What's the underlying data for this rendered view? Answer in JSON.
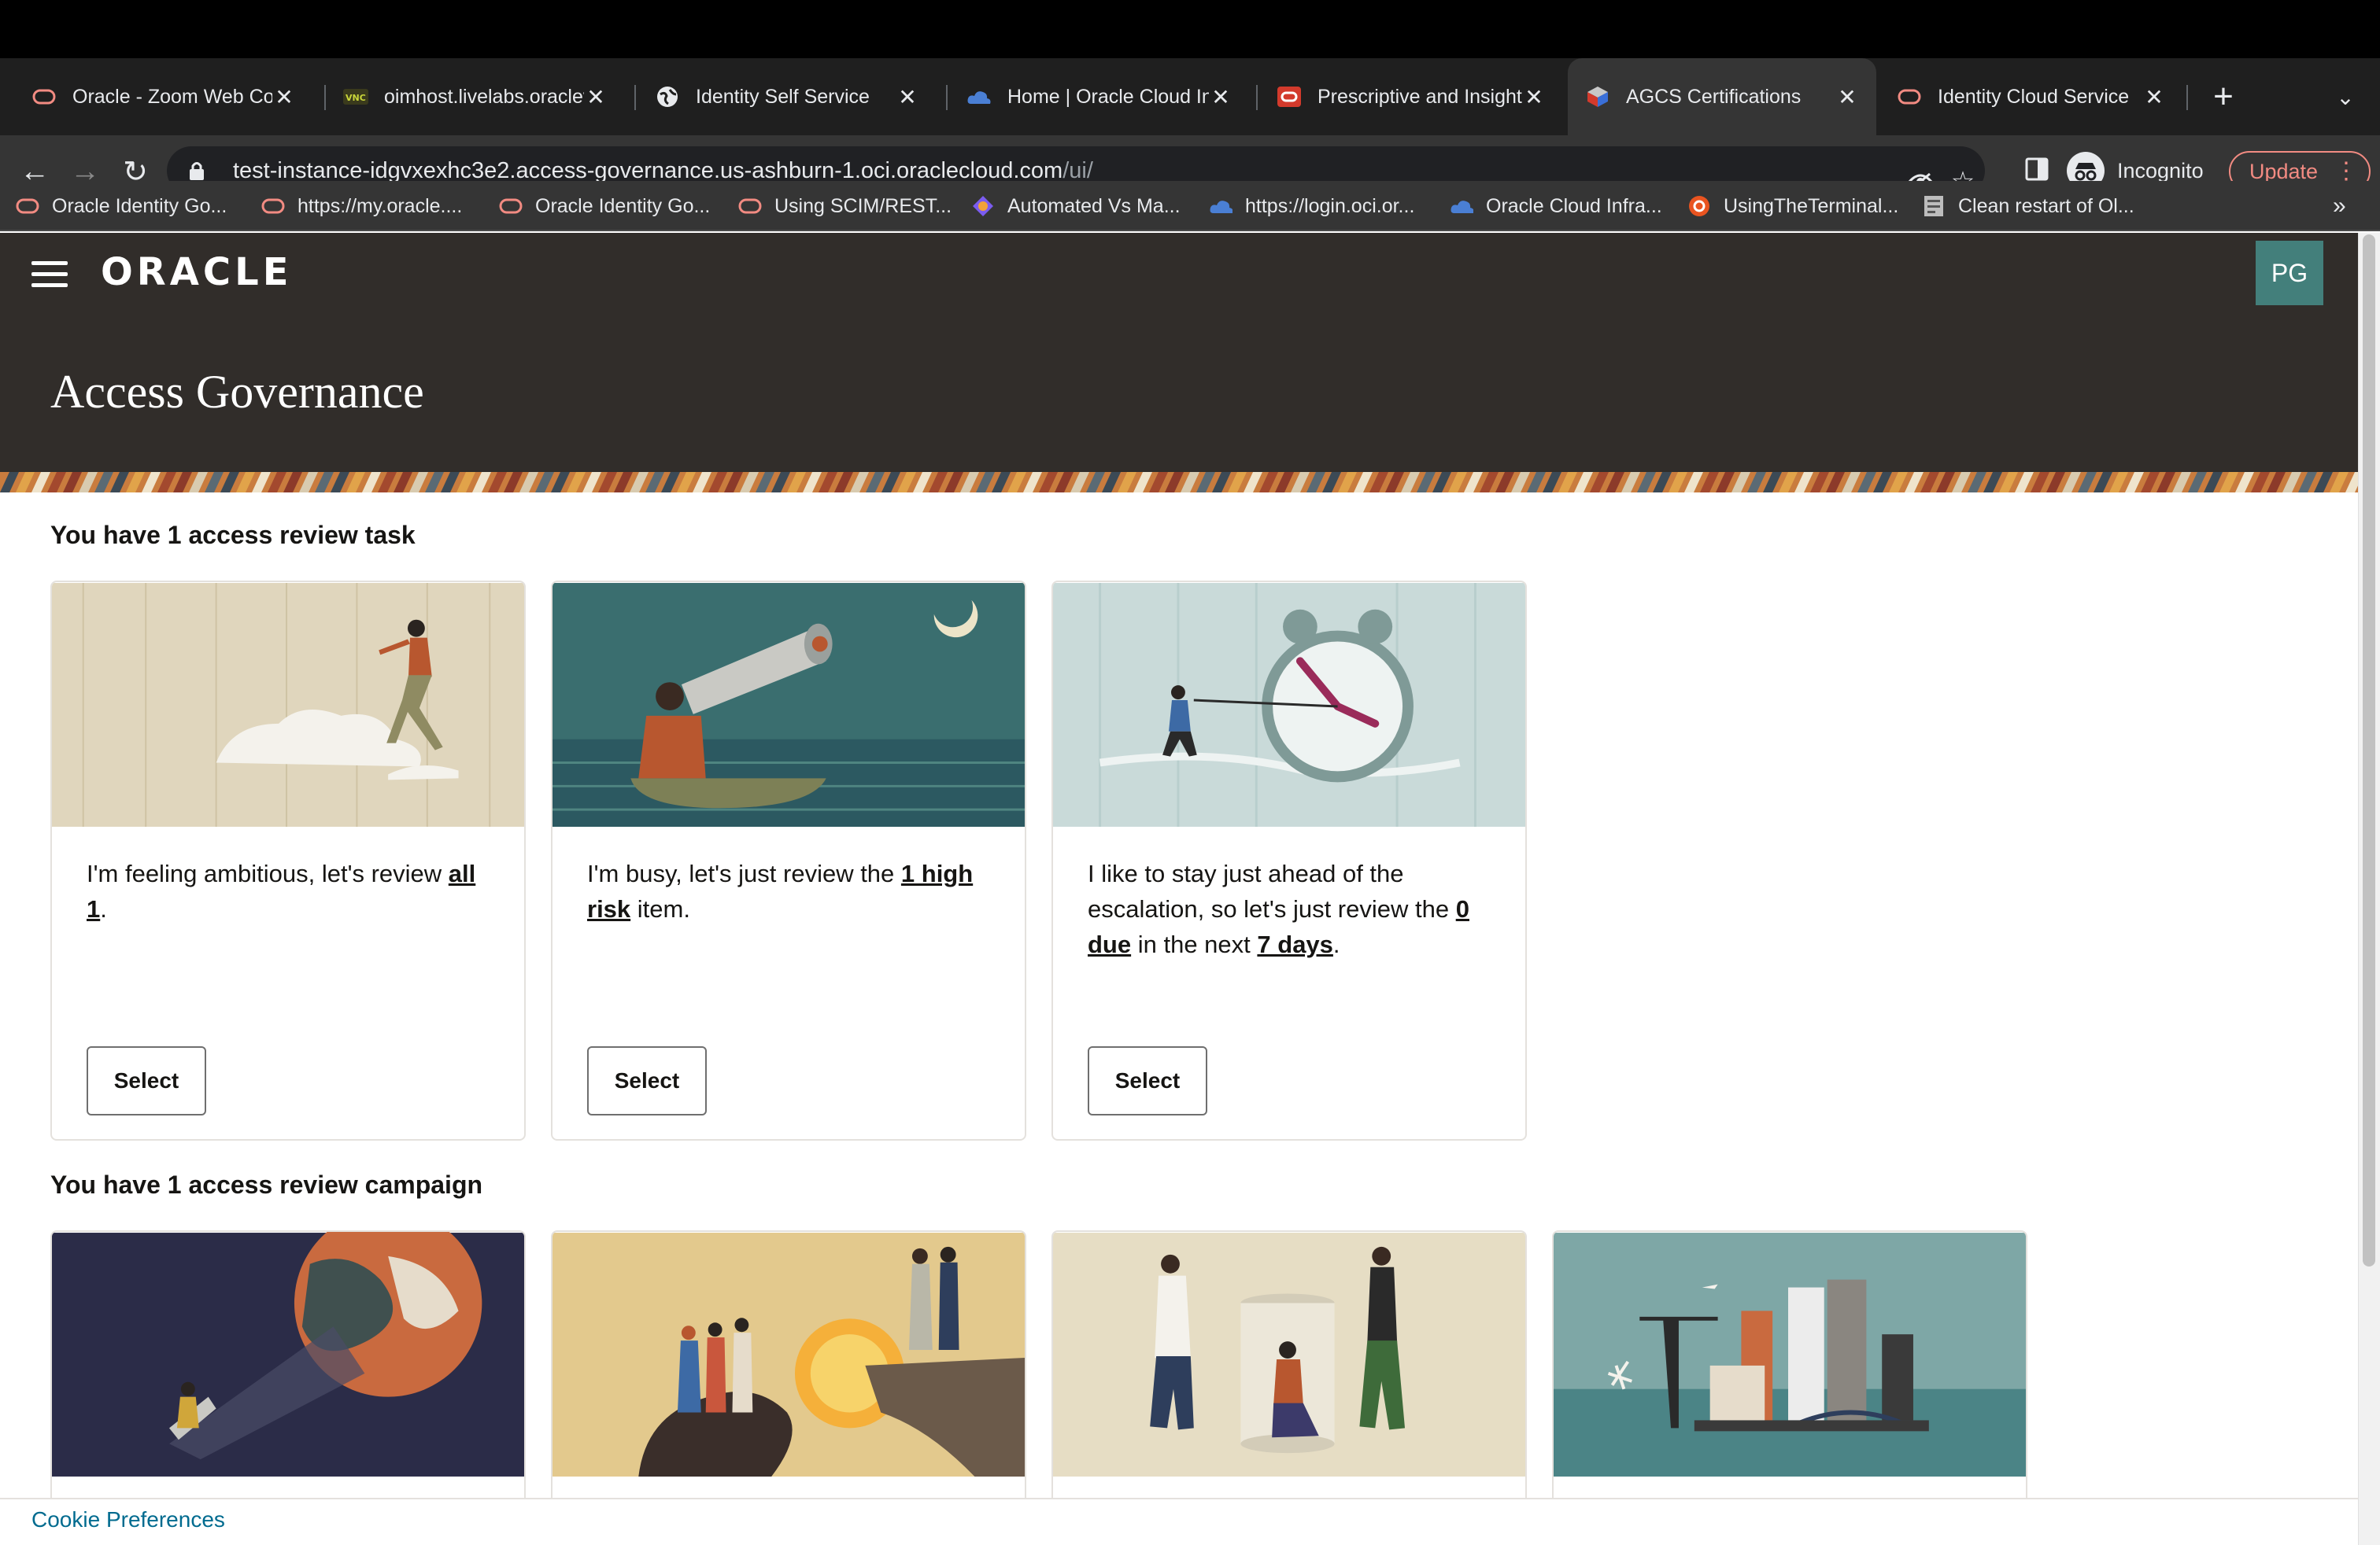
{
  "browser": {
    "tabs": [
      {
        "title": "Oracle - Zoom Web Cor",
        "icon": "oracle-icon"
      },
      {
        "title": "oimhost.livelabs.oraclev",
        "icon": "vnc-icon"
      },
      {
        "title": "Identity Self Service",
        "icon": "globe-icon"
      },
      {
        "title": "Home | Oracle Cloud Inf",
        "icon": "cloud-icon"
      },
      {
        "title": "Prescriptive and Insight",
        "icon": "oracle-red-icon"
      },
      {
        "title": "AGCS Certifications",
        "icon": "agcs-icon",
        "active": true
      },
      {
        "title": "Identity Cloud Service",
        "icon": "oracle-icon"
      }
    ],
    "url_host": "test-instance-idgvxexhc3e2.access-governance.us-ashburn-1.oci.oraclecloud.com",
    "url_path": "/ui/",
    "incognito_label": "Incognito",
    "update_label": "Update",
    "bookmarks": [
      {
        "label": "Oracle Identity Go...",
        "icon": "oracle-icon"
      },
      {
        "label": "https://my.oracle....",
        "icon": "oracle-icon"
      },
      {
        "label": "Oracle Identity Go...",
        "icon": "oracle-icon"
      },
      {
        "label": "Using SCIM/REST...",
        "icon": "oracle-icon"
      },
      {
        "label": "Automated Vs Ma...",
        "icon": "app-icon"
      },
      {
        "label": "https://login.oci.or...",
        "icon": "cloud-icon"
      },
      {
        "label": "Oracle Cloud Infra...",
        "icon": "cloud-icon"
      },
      {
        "label": "UsingTheTerminal...",
        "icon": "ubuntu-icon"
      },
      {
        "label": "Clean restart of Ol...",
        "icon": "page-icon"
      }
    ],
    "bookmarks_more": "»"
  },
  "header": {
    "logo": "ORACLE",
    "avatar_initials": "PG",
    "title": "Access Governance"
  },
  "tasks": {
    "heading": "You have 1 access review task",
    "cards": [
      {
        "pre": "I'm feeling ambitious, let's review ",
        "b1": "all 1",
        "post": ".",
        "button": "Select"
      },
      {
        "pre": "I'm busy, let's just review the ",
        "b1": "1 high risk",
        "post": " item.",
        "button": "Select"
      },
      {
        "pre": "I like to stay just ahead of the escalation, so let's just review the ",
        "b1": "0 due",
        "mid": " in the next ",
        "b2": "7 days",
        "post": ".",
        "button": "Select"
      }
    ]
  },
  "campaigns": {
    "heading": "You have 1 access review campaign"
  },
  "footer": {
    "cookie_label": "Cookie Preferences"
  },
  "colors": {
    "header_bg": "#312d2a",
    "avatar_bg": "#437f7b",
    "link": "#006b8f"
  }
}
